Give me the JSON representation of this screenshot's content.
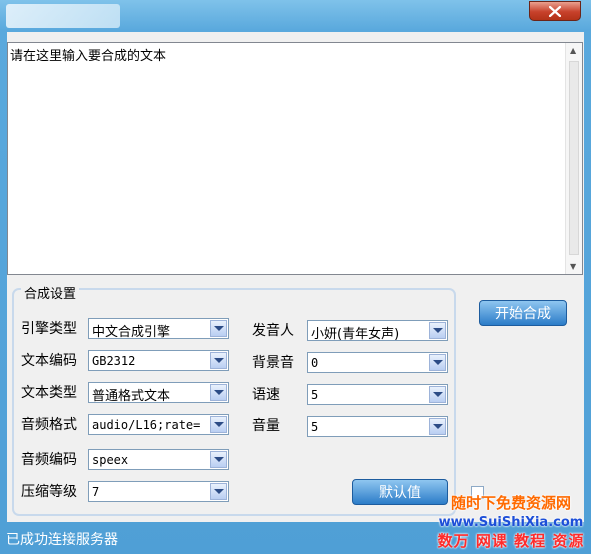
{
  "window": {
    "title": ""
  },
  "editor": {
    "text": "请在这里输入要合成的文本"
  },
  "settings": {
    "group_title": "合成设置",
    "engine_type": {
      "label": "引擎类型",
      "value": "中文合成引擎"
    },
    "text_encoding": {
      "label": "文本编码",
      "value": "GB2312"
    },
    "text_type": {
      "label": "文本类型",
      "value": "普通格式文本"
    },
    "audio_format": {
      "label": "音频格式",
      "value": "audio/L16;rate="
    },
    "audio_encoding": {
      "label": "音频编码",
      "value": "speex"
    },
    "compression_level": {
      "label": "压缩等级",
      "value": "7"
    },
    "speaker": {
      "label": "发音人",
      "value": "小妍(青年女声)"
    },
    "background_sound": {
      "label": "背景音",
      "value": "0"
    },
    "speed": {
      "label": "语速",
      "value": "5"
    },
    "volume": {
      "label": "音量",
      "value": "5"
    }
  },
  "buttons": {
    "start": "开始合成",
    "default": "默认值"
  },
  "status": {
    "text": "已成功连接服务器"
  },
  "watermark": {
    "line1": "随时下免费资源网",
    "line2": "www.SuiShiXia.com",
    "line3": "数万 网课 教程 资源"
  },
  "colors": {
    "title_bar": "#5aa9dd",
    "close_button": "#c7412b",
    "button": "#2c7cc8"
  }
}
